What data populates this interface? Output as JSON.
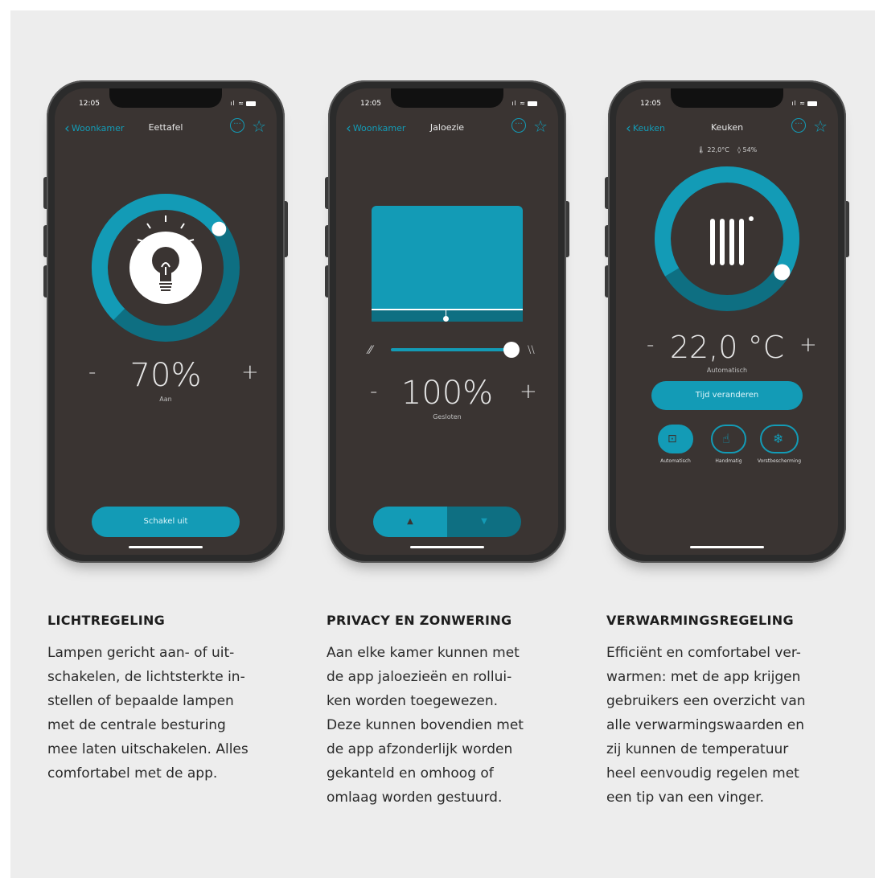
{
  "phones": [
    {
      "time": "12:05",
      "back_label": "Woonkamer",
      "title": "Eettafel",
      "value": "70%",
      "value_fraction": 0.7,
      "minus": "-",
      "plus": "+",
      "sublabel": "Aan",
      "button_label": "Schakel uit"
    },
    {
      "time": "12:05",
      "back_label": "Woonkamer",
      "title": "Jaloezie",
      "value": "100%",
      "value_fraction": 1.0,
      "minus": "-",
      "plus": "+",
      "sublabel": "Gesloten",
      "up_glyph": "▲",
      "down_glyph": "▼"
    },
    {
      "time": "12:05",
      "back_label": "Keuken",
      "title": "Keuken",
      "temperature_reading": "22,0°C",
      "humidity_reading": "54%",
      "value": "22,0 °C",
      "minus": "-",
      "plus": "+",
      "sublabel": "Automatisch",
      "button_label": "Tijd veranderen",
      "modes": [
        {
          "label": "Automatisch",
          "icon": "robot-icon",
          "active": true
        },
        {
          "label": "Handmatig",
          "icon": "hand-icon",
          "active": false
        },
        {
          "label": "Vorstbescherming",
          "icon": "snowflake-icon",
          "active": false
        }
      ]
    }
  ],
  "sections": [
    {
      "heading": "LICHTREGELING",
      "body": "Lampen gericht aan- of uit-\nschakelen, de lichtsterkte in-\nstellen of bepaalde lampen\nmet de centrale besturing\nmee laten uitschakelen. Alles\ncomfortabel met de app."
    },
    {
      "heading": "PRIVACY EN ZONWERING",
      "body": "Aan elke kamer kunnen met\nde app jaloezieën en rollui-\nken worden toegewezen.\nDeze kunnen bovendien met\nde app afzonderlijk worden\ngekanteld en omhoog of\nomlaag worden gestuurd."
    },
    {
      "heading": "VERWARMINGSREGELING",
      "body": "Efficiënt en comfortabel ver-\nwarmen: met de app krijgen\ngebruikers een overzicht van\nalle verwarmingswaarden en\nzij kunnen de temperatuur\nheel eenvoudig regelen met\neen tip van een vinger."
    }
  ],
  "colors": {
    "accent": "#139bb6",
    "accent_dark": "#0e7488",
    "screen_bg": "#3a3432",
    "page_bg": "#ededed"
  }
}
